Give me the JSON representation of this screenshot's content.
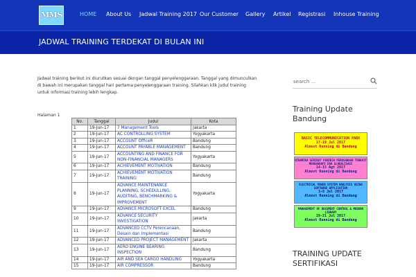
{
  "logo": {
    "text": "MMS"
  },
  "nav": [
    {
      "label": "HOME",
      "active": true
    },
    {
      "label": "About Us",
      "active": false
    },
    {
      "label": "Jadwal Training 2017",
      "active": false
    },
    {
      "label": "Our Customer",
      "active": false
    },
    {
      "label": "Gallery",
      "active": false
    },
    {
      "label": "Artikel",
      "active": false
    },
    {
      "label": "Registrasi",
      "active": false
    },
    {
      "label": "Inhouse Training",
      "active": false
    }
  ],
  "page_title": "JADWAL TRAINING TERDEKAT DI BULAN INI",
  "intro": "Jadwal training berikut ini diurutkan sesuai dengan tanggal penyelenggaraan. Tanggal yang dimunculkan di bawah ini merupakan tanggal hari pertama penyelenggaraan training. Silahkan klik judul training untuk informasi training lebih lengkap.",
  "halaman": "Halaman 1",
  "table": {
    "headers": [
      "No.",
      "Tanggal",
      "Judul",
      "Kota"
    ],
    "rows": [
      {
        "no": "1",
        "tanggal": "19-Jun-17",
        "judul": "7 Management Tools",
        "kota": "Jakarta",
        "lines": 1
      },
      {
        "no": "2",
        "tanggal": "19-Jun-17",
        "judul": "AC CONTROLLING SYSTEM",
        "kota": "Yogyakarta",
        "lines": 1
      },
      {
        "no": "3",
        "tanggal": "19-Jun-17",
        "judul": "ACCOUNT OfficeR",
        "kota": "Bandung",
        "lines": 1
      },
      {
        "no": "4",
        "tanggal": "19-Jun-17",
        "judul": "ACCOUNT PAYABLE MANAGEMENT",
        "kota": "Bandung",
        "lines": 1
      },
      {
        "no": "5",
        "tanggal": "19-Jun-17",
        "judul": "ACCOUNTING AND FINANCE FOR NON-FINANCIAL MANAGERS",
        "kota": "Yogyakarta",
        "lines": 2
      },
      {
        "no": "6",
        "tanggal": "19-Jun-17",
        "judul": "ACHIEVEMENT MOTIVATION",
        "kota": "Bandung",
        "lines": 1
      },
      {
        "no": "7",
        "tanggal": "19-Jun-17",
        "judul": "ACHIEVEMENT MOTIVATION TRAINING",
        "kota": "Bandung",
        "lines": 2
      },
      {
        "no": "8",
        "tanggal": "19-Jun-17",
        "judul": "ADVANCE MAINTENANCE PLANNING, SCHEDULLING, AUDITING, BENCHMARKING & IMPROVEMENT",
        "kota": "Yogyakarta",
        "lines": 3
      },
      {
        "no": "9",
        "tanggal": "19-Jun-17",
        "judul": "ADVANCE MICROSOFT EXCEL",
        "kota": "Bandung",
        "lines": 1
      },
      {
        "no": "10",
        "tanggal": "19-Jun-17",
        "judul": "ADVANCE SECURITY INVESTIGATION",
        "kota": "Jakarta",
        "lines": 1
      },
      {
        "no": "11",
        "tanggal": "19-Jun-17",
        "judul": "ADVANCED CCTV Perencanaan, Desain dan Implementasi",
        "kota": "Bandung",
        "lines": 2
      },
      {
        "no": "12",
        "tanggal": "19-Jun-17",
        "judul": "ADVANCED PROJECT MANAGEMENT",
        "kota": "Jakarta",
        "lines": 1
      },
      {
        "no": "13",
        "tanggal": "19-Jun-17",
        "judul": "AERO ENGINE BEARING INSPECTION",
        "kota": "Bandung",
        "lines": 1
      },
      {
        "no": "14",
        "tanggal": "19-Jun-17",
        "judul": "AIR AND SEA CARGO HANDLING",
        "kota": "Yogyakarta",
        "lines": 1
      },
      {
        "no": "15",
        "tanggal": "19-Jun-17",
        "judul": "AIR COMPRESSOR",
        "kota": "Bandung",
        "lines": 1
      }
    ]
  },
  "search": {
    "placeholder": "search ..."
  },
  "widgets": {
    "training_update_bandung": "Training Update Bandung",
    "training_update_sertifikasi": "TRAINING UPDATE SERTIFIKASI"
  },
  "banners": [
    {
      "l1": "BASIC TELECOMMUNICATION PABX",
      "l2": "17-19 Jul 2017",
      "l3": "Almost Running di Bandung",
      "bg": "#ffff00",
      "fg": "#c00000"
    },
    {
      "l1": "DINAMIKA SERIKAT PEKERJA PERUSAHAAN TERKAIT MENGHADAPI ERA GLOBALISASI",
      "l2": "14-15 Agt 2017",
      "l3": "Almost Running di Bandung",
      "bg": "#ff7fd0",
      "fg": "#1a1a8c"
    },
    {
      "l1": "ELECTRICAL POWER SYSTEM ANALYSIS USING SOFTWARE APPLICATION",
      "l2": "3-6 Jul 2017",
      "l3": "Almost Running di Bandung",
      "bg": "#4fb8ff",
      "fg": "#10106a"
    },
    {
      "l1": "MANAGEMENT OF DOCUMENT CONTROL & MODERN LIBRARY",
      "l2": "19-21 Jul 2017",
      "l3": "Almost Running di Bandung",
      "bg": "#7fff5f",
      "fg": "#10106a"
    }
  ],
  "colors": {
    "nav_bg": "#1435b7",
    "hero_bg": "#0b24a5",
    "link": "#1a3cb8"
  }
}
